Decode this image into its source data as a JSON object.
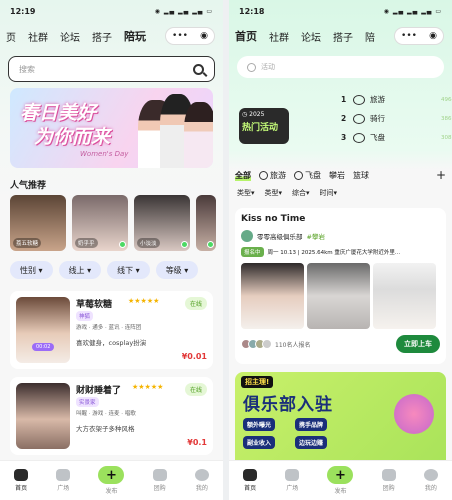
{
  "left": {
    "status": {
      "time": "12:19",
      "battery": "66"
    },
    "tabs": [
      "页",
      "社群",
      "论坛",
      "搭子",
      "陪玩"
    ],
    "active_tab": "陪玩",
    "search": {
      "placeholder": "搜索"
    },
    "banner": {
      "line1": "春日美好",
      "line2": "为你而来",
      "line3": "Women's Day"
    },
    "popular_title": "人气推荐",
    "popular": [
      {
        "name": "荔五软糖"
      },
      {
        "name": "奶乎乎"
      },
      {
        "name": "小淡淡"
      },
      {
        "name": ""
      }
    ],
    "filters": [
      "性别",
      "线上",
      "线下",
      "等级"
    ],
    "cards": [
      {
        "name": "草莓软糖",
        "rank": "神狐",
        "tags_line": "游戏 · 通多 · 蓝讯 · 连阵团",
        "desc": "喜欢健身，cosplay扮演",
        "price": "¥0.01",
        "online": "在线",
        "voice": "00:02"
      },
      {
        "name": "财财睡着了",
        "rank": "实景家",
        "tags_line": "叫醒 · 游戏 · 连麦 · 唱歌",
        "desc": "大方衣架子多种风格",
        "price": "¥0.1",
        "online": "在线",
        "voice": ""
      }
    ],
    "nav": [
      "首页",
      "广场",
      "发布",
      "团购",
      "我的"
    ]
  },
  "right": {
    "status": {
      "time": "12:18",
      "battery": "66"
    },
    "tabs": [
      "首页",
      "社群",
      "论坛",
      "搭子",
      "陪"
    ],
    "active_tab": "首页",
    "search": {
      "placeholder": "活动"
    },
    "hot_badge": {
      "year": "2025",
      "headline": "热门活动"
    },
    "ranking": [
      {
        "n": "1",
        "name": "旅游",
        "val": "4964"
      },
      {
        "n": "2",
        "name": "骑行",
        "val": "3867"
      },
      {
        "n": "3",
        "name": "飞盘",
        "val": "3087"
      }
    ],
    "cat_tabs": [
      "全部",
      "旅游",
      "飞盘",
      "攀岩",
      "篮球"
    ],
    "active_cat": "全部",
    "sub_filters": [
      "类型▾",
      "类型▾",
      "综合▾",
      "时间▾"
    ],
    "post": {
      "title": "Kiss no Time",
      "club": "零零高级俱乐部",
      "topic": "#攀岩",
      "meta_tag": "报名中",
      "meta": "周一 10.13 | 2025.64km 重庆广厦花大学附近外里...",
      "joined": "110名人报名",
      "cta": "立即上车"
    },
    "ad": {
      "tag": "招主理!",
      "headline": "俱乐部入驻",
      "chips": [
        "额外曝光",
        "携手品牌",
        "副业收入",
        "边玩边赚"
      ]
    },
    "nav": [
      "首页",
      "广场",
      "发布",
      "团购",
      "我的"
    ]
  },
  "colors": {
    "accent": "#b6f36a",
    "price": "#e23838",
    "cta": "#1e8a3d"
  }
}
